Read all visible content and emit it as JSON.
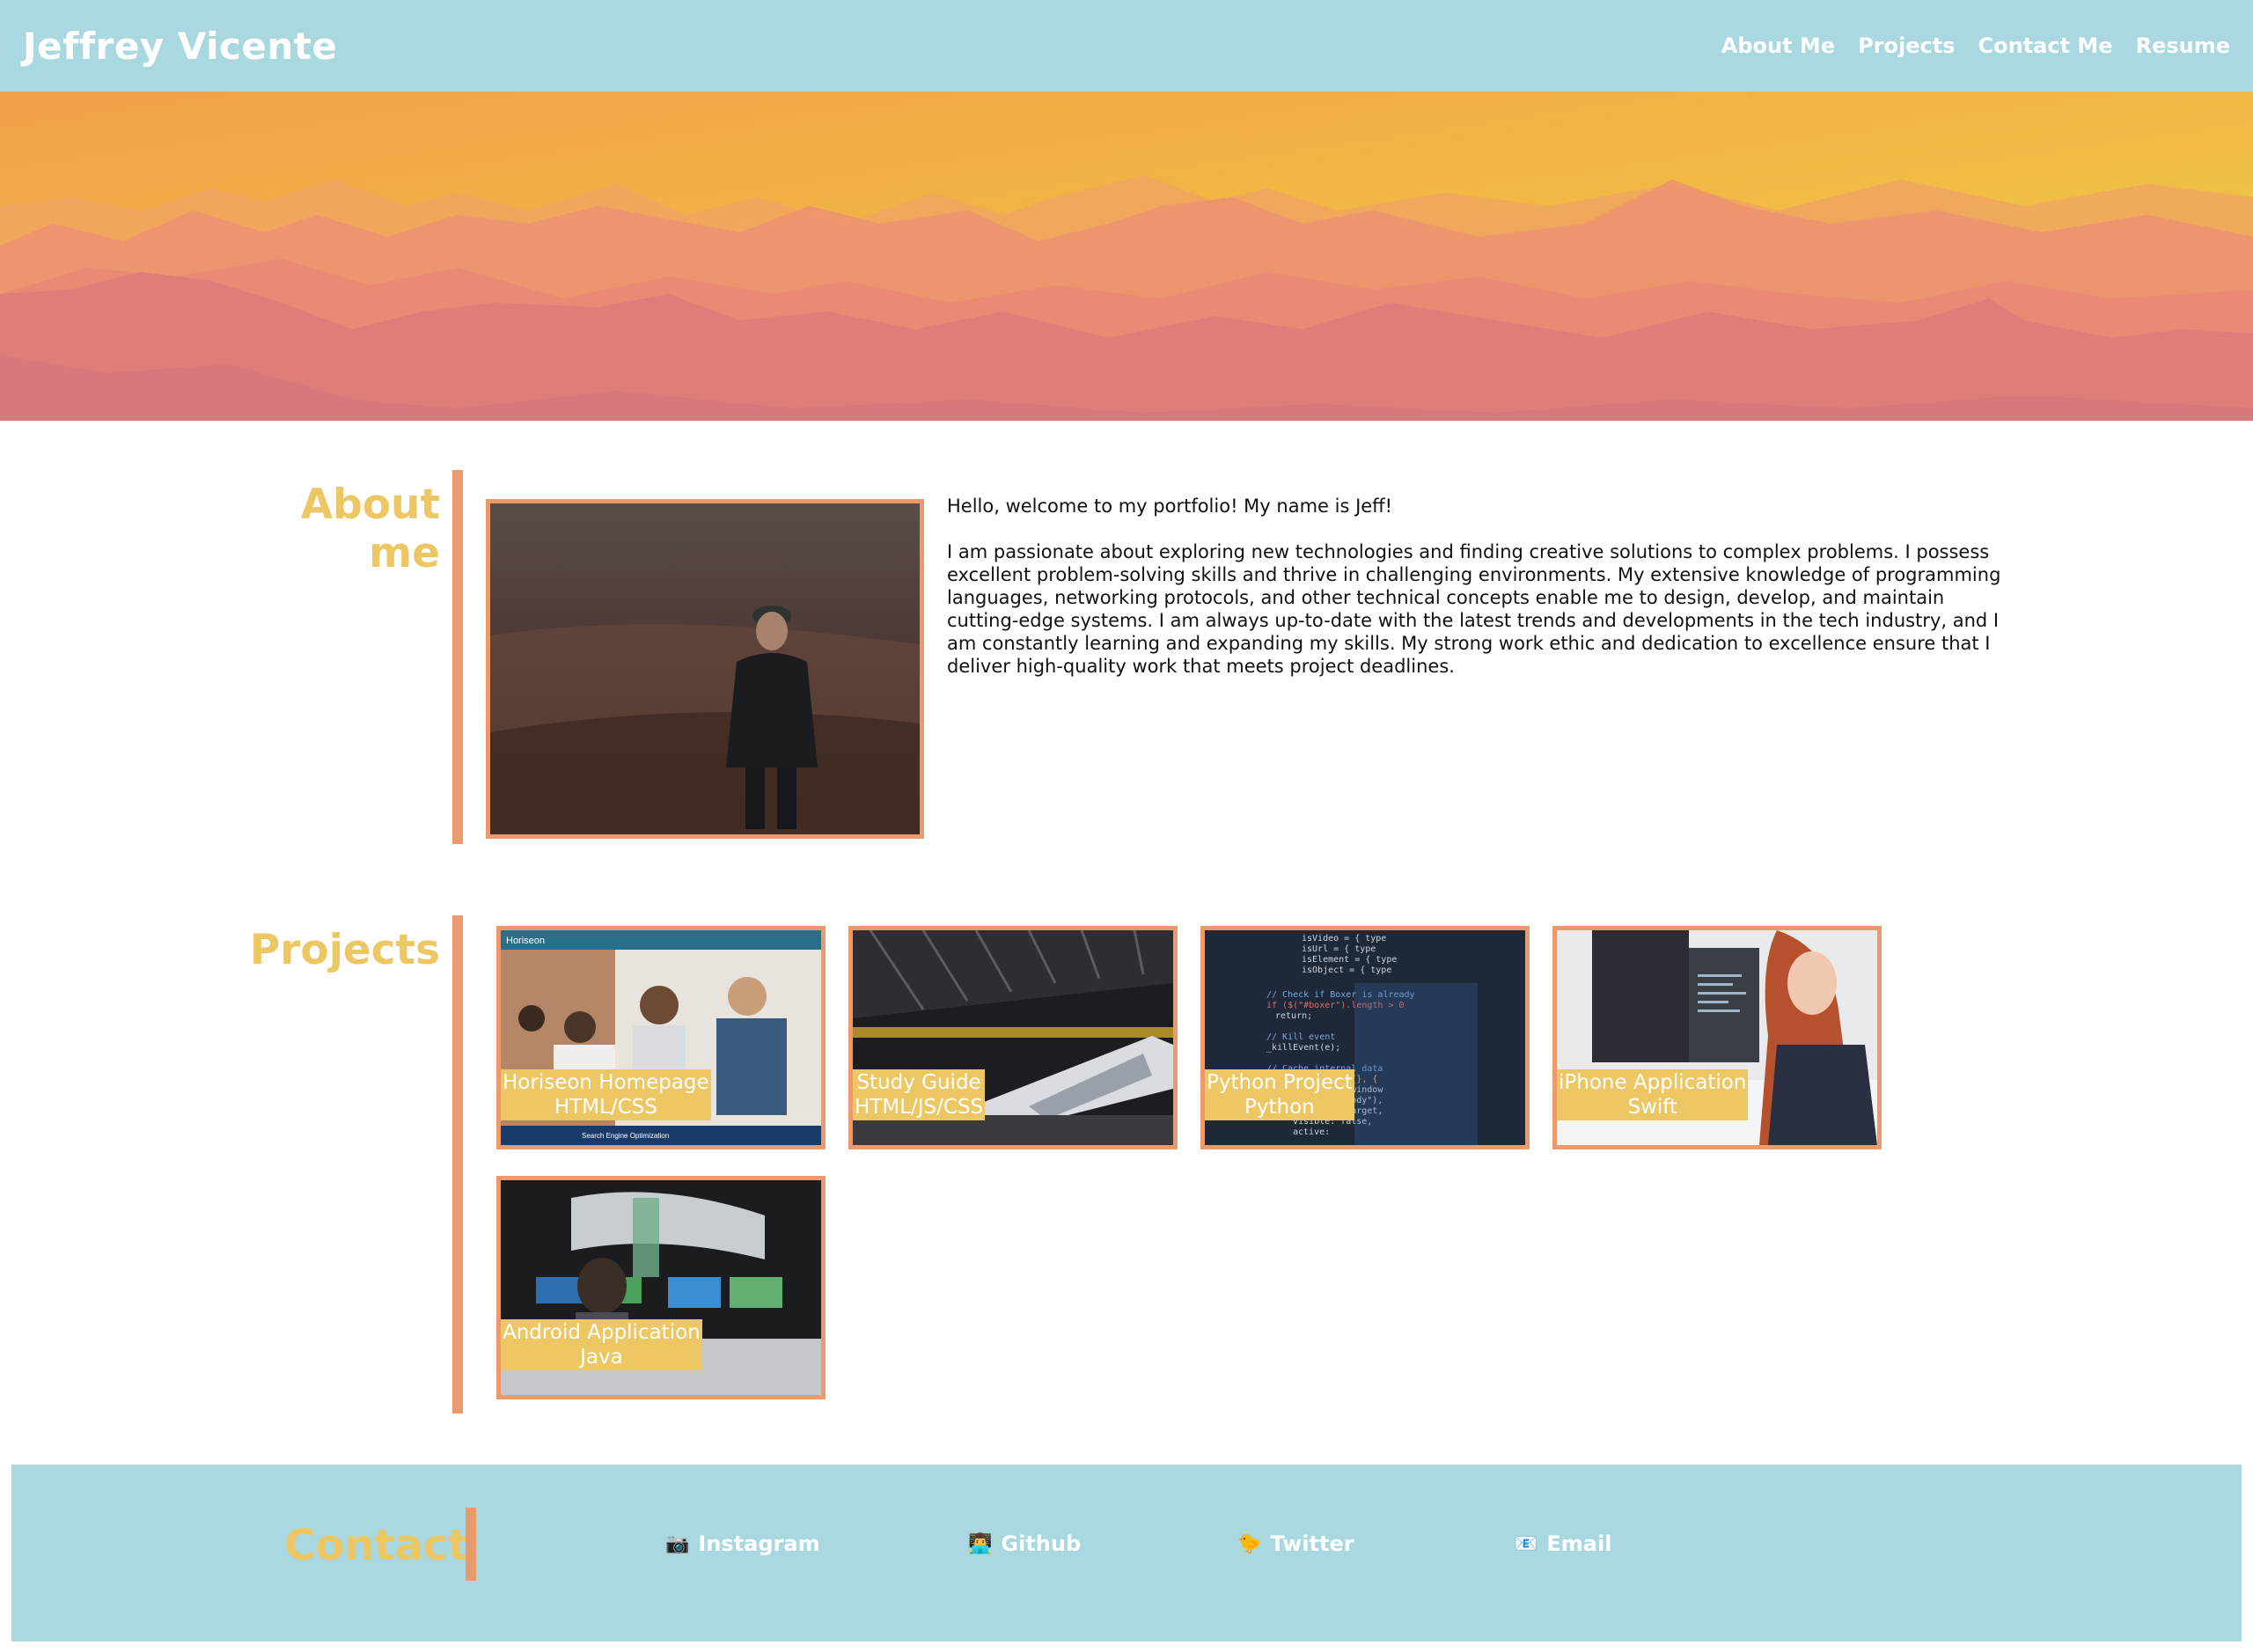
{
  "header": {
    "title": "Jeffrey Vicente",
    "nav": [
      "About Me",
      "Projects",
      "Contact Me",
      "Resume"
    ]
  },
  "about": {
    "heading": "About me",
    "intro": "Hello, welcome to my portfolio! My name is Jeff!",
    "body": "I am passionate about exploring new technologies and finding creative solutions to complex problems. I possess excellent problem-solving skills and thrive in challenging environments. My extensive knowledge of programming languages, networking protocols, and other technical concepts enable me to design, develop, and maintain cutting-edge systems. I am always up-to-date with the latest trends and developments in the tech industry, and I am constantly learning and expanding my skills. My strong work ethic and dedication to excellence ensure that I deliver high-quality work that meets project deadlines."
  },
  "projects": {
    "heading": "Projects",
    "items": [
      {
        "title": "Horiseon Homepage",
        "tech": "HTML/CSS",
        "thumb_text": "Horiseon",
        "thumb_banner": "Search Engine Optimization"
      },
      {
        "title": "Study Guide",
        "tech": "HTML/JS/CSS"
      },
      {
        "title": "Python Project",
        "tech": "Python"
      },
      {
        "title": "iPhone Application",
        "tech": "Swift"
      },
      {
        "title": "Android Application",
        "tech": "Java"
      }
    ]
  },
  "contact": {
    "heading": "Contact",
    "links": [
      {
        "label": "Instagram",
        "icon": "camera-icon",
        "glyph": "📷"
      },
      {
        "label": "Github",
        "icon": "person-icon",
        "glyph": "👨‍💻"
      },
      {
        "label": "Twitter",
        "icon": "bird-icon",
        "glyph": "🐤"
      },
      {
        "label": "Email",
        "icon": "mail-icon",
        "glyph": "📧"
      }
    ]
  },
  "colors": {
    "header_bg": "#a9d8e0",
    "accent_yellow": "#eec765",
    "accent_orange": "#ec9a6c"
  }
}
